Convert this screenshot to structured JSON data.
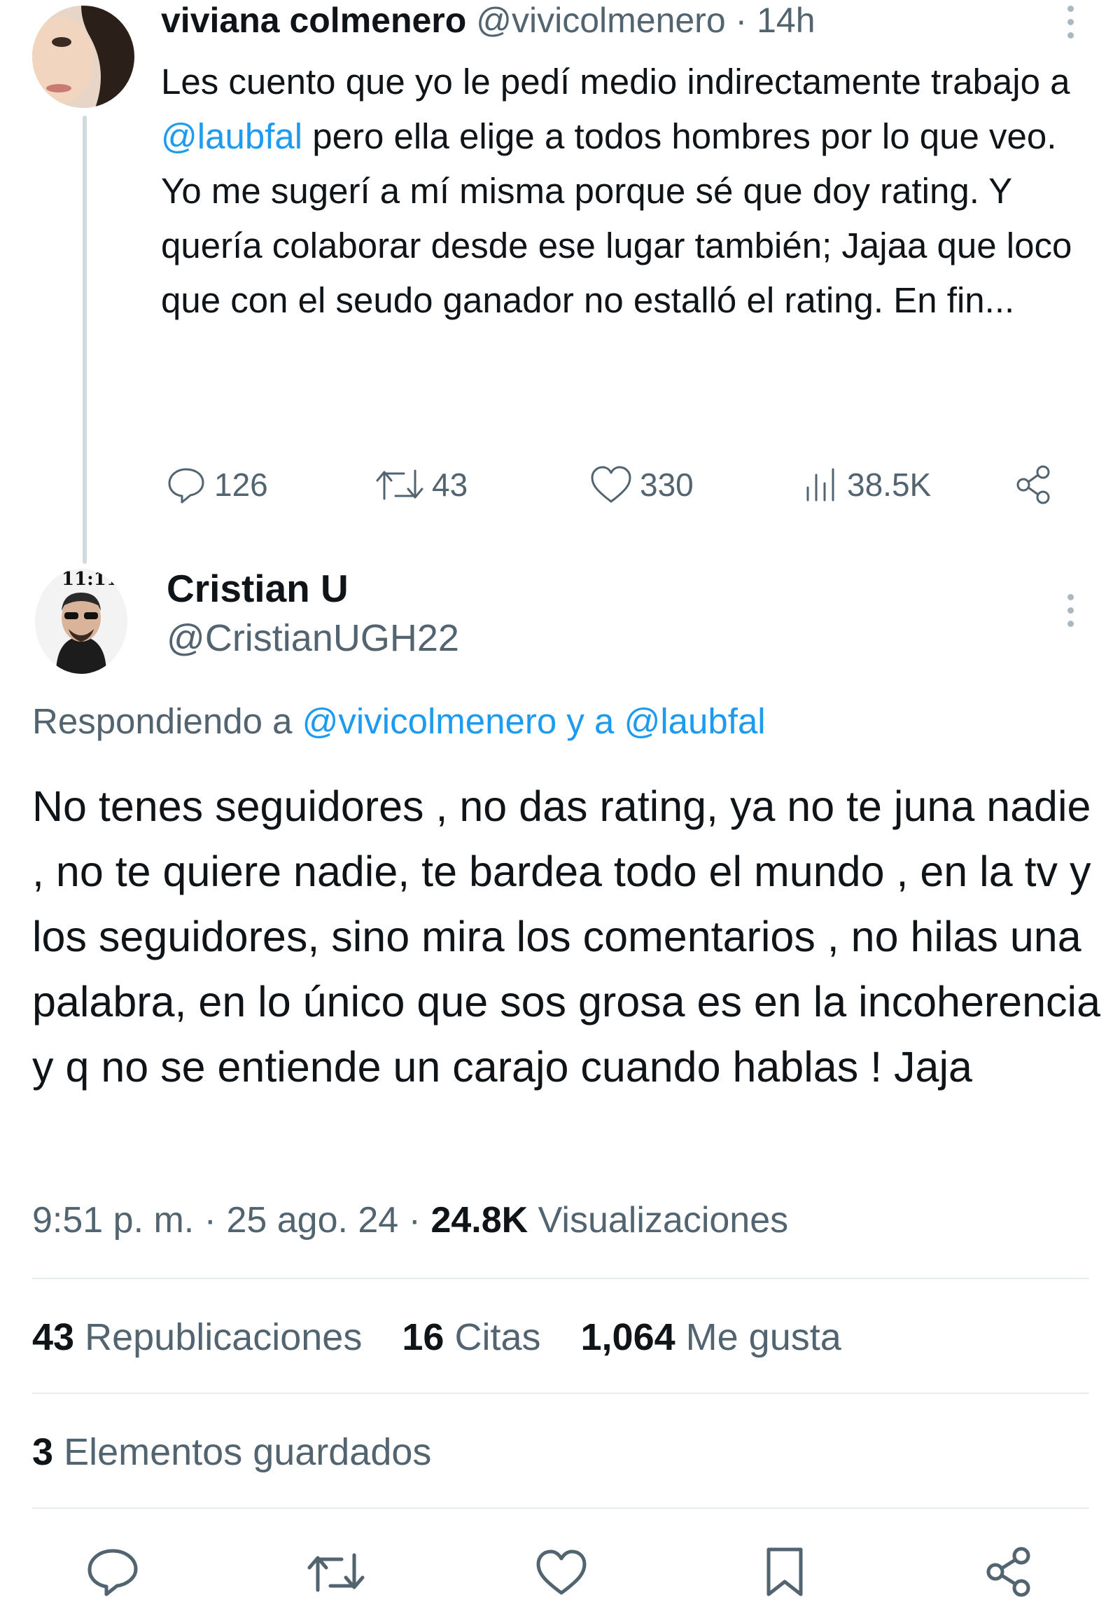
{
  "parent_tweet": {
    "author_name": "viviana colmenero",
    "handle_time": "@vivicolmenero · 14h",
    "text_before_mention": "Les cuento que yo le pedí medio indirectamente trabajo a ",
    "mention": "@laubfal",
    "text_after_mention": "  pero ella elige a todos hombres por lo que veo. Yo me sugerí a mí misma porque sé que doy rating. Y quería colaborar desde ese lugar también; Jajaa que loco que con el seudo ganador no estalló el rating. En fin...",
    "stats": {
      "replies": "126",
      "reposts": "43",
      "likes": "330",
      "views": "38.5K"
    }
  },
  "main_tweet": {
    "author_name": "Cristian U",
    "handle": "@CristianUGH22",
    "avatar_overlay_text": "11:11",
    "replying_prefix": "Respondiendo a ",
    "replying_mention_1": "@vivicolmenero",
    "replying_join": " y a ",
    "replying_mention_2": "@laubfal",
    "text": "No tenes seguidores , no das rating, ya no te juna nadie , no te quiere nadie, te bardea todo el mundo , en la tv y los seguidores, sino mira los comentarios , no hilas una palabra, en lo único que sos grosa es en la incoherencia y q no se entiende un carajo cuando hablas ! Jaja",
    "time_date": "9:51 p. m. · 25 ago. 24 · ",
    "views_count": "24.8K",
    "views_label": " Visualizaciones",
    "reposts_count": "43",
    "reposts_label": "Republicaciones",
    "quotes_count": "16",
    "quotes_label": "Citas",
    "likes_count": "1,064",
    "likes_label": "Me gusta",
    "bookmarks_count": "3",
    "bookmarks_label": "Elementos guardados"
  },
  "icons": {
    "reply": "reply-icon",
    "repost": "repost-icon",
    "like": "like-icon",
    "views": "views-icon",
    "share": "share-icon",
    "bookmark": "bookmark-icon",
    "more": "more-options-icon"
  },
  "colors": {
    "link": "#1d9bf0",
    "muted": "#536471",
    "text": "#0f1419",
    "thread_line": "#cfd9de"
  }
}
